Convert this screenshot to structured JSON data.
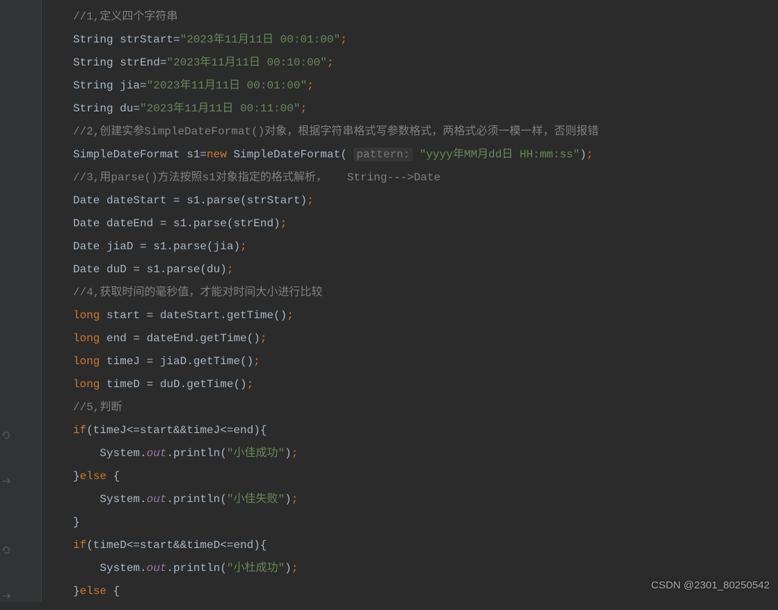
{
  "code": {
    "lines": [
      {
        "type": "comment",
        "content": "//1,定义四个字符串"
      },
      {
        "type": "var-decl",
        "typeName": "String",
        "varName": "strStart",
        "op": "=",
        "value": "\"2023年11月11日 00:01:00\"",
        "semi": ";"
      },
      {
        "type": "var-decl",
        "typeName": "String",
        "varName": "strEnd",
        "op": "=",
        "value": "\"2023年11月11日 00:10:00\"",
        "semi": ";"
      },
      {
        "type": "var-decl",
        "typeName": "String",
        "varName": "jia",
        "op": "=",
        "value": "\"2023年11月11日 00:01:00\"",
        "semi": ";"
      },
      {
        "type": "var-decl",
        "typeName": "String",
        "varName": "du",
        "op": "=",
        "value": "\"2023年11月11日 00:11:00\"",
        "semi": ";"
      },
      {
        "type": "comment",
        "content": "//2,创建实参SimpleDateFormat()对象，根据字符串格式写参数格式，两格式必须一模一样，否则报错"
      },
      {
        "type": "new-obj",
        "typeName": "SimpleDateFormat",
        "varName": "s1",
        "op": "=",
        "keyword": "new",
        "ctor": "SimpleDateFormat",
        "hint": "pattern:",
        "arg": "\"yyyy年MM月dd日 HH:mm:ss\"",
        "semi": ";"
      },
      {
        "type": "comment",
        "content": "//3,用parse()方法按照s1对象指定的格式解析，   String--->Date"
      },
      {
        "type": "stmt",
        "prefix": "Date dateStart = s1.parse(strStart)",
        "semi": ";"
      },
      {
        "type": "stmt",
        "prefix": "Date dateEnd = s1.parse(strEnd)",
        "semi": ";"
      },
      {
        "type": "stmt",
        "prefix": "Date jiaD = s1.parse(jia)",
        "semi": ";"
      },
      {
        "type": "stmt",
        "prefix": "Date duD = s1.parse(du)",
        "semi": ";"
      },
      {
        "type": "comment",
        "content": "//4,获取时间的毫秒值，才能对时间大小进行比较"
      },
      {
        "type": "prim-decl",
        "keyword": "long",
        "rest": " start = dateStart.getTime()",
        "semi": ";"
      },
      {
        "type": "prim-decl",
        "keyword": "long",
        "rest": " end = dateEnd.getTime()",
        "semi": ";"
      },
      {
        "type": "prim-decl",
        "keyword": "long",
        "rest": " timeJ = jiaD.getTime()",
        "semi": ";"
      },
      {
        "type": "prim-decl",
        "keyword": "long",
        "rest": " timeD = duD.getTime()",
        "semi": ";"
      },
      {
        "type": "comment",
        "content": "//5,判断"
      },
      {
        "type": "if",
        "keyword": "if",
        "cond": "(timeJ<=start&&timeJ<=end){"
      },
      {
        "type": "sysout",
        "indent": "    ",
        "obj": "System.",
        "field": "out",
        "method": ".println(",
        "arg": "\"小佳成功\"",
        "close": ")",
        "semi": ";"
      },
      {
        "type": "else",
        "close": "}",
        "keyword": "else",
        "open": " {"
      },
      {
        "type": "sysout",
        "indent": "    ",
        "obj": "System.",
        "field": "out",
        "method": ".println(",
        "arg": "\"小佳失败\"",
        "close": ")",
        "semi": ";"
      },
      {
        "type": "brace",
        "content": "}"
      },
      {
        "type": "if",
        "keyword": "if",
        "cond": "(timeD<=start&&timeD<=end){"
      },
      {
        "type": "sysout",
        "indent": "    ",
        "obj": "System.",
        "field": "out",
        "method": ".println(",
        "arg": "\"小杜成功\"",
        "close": ")",
        "semi": ";"
      },
      {
        "type": "else",
        "close": "}",
        "keyword": "else",
        "open": " {"
      }
    ]
  },
  "gutterIcons": [
    {
      "line": 19,
      "type": "loop"
    },
    {
      "line": 21,
      "type": "arrow"
    },
    {
      "line": 24,
      "type": "loop"
    },
    {
      "line": 26,
      "type": "arrow"
    }
  ],
  "watermark": "CSDN @2301_80250542"
}
